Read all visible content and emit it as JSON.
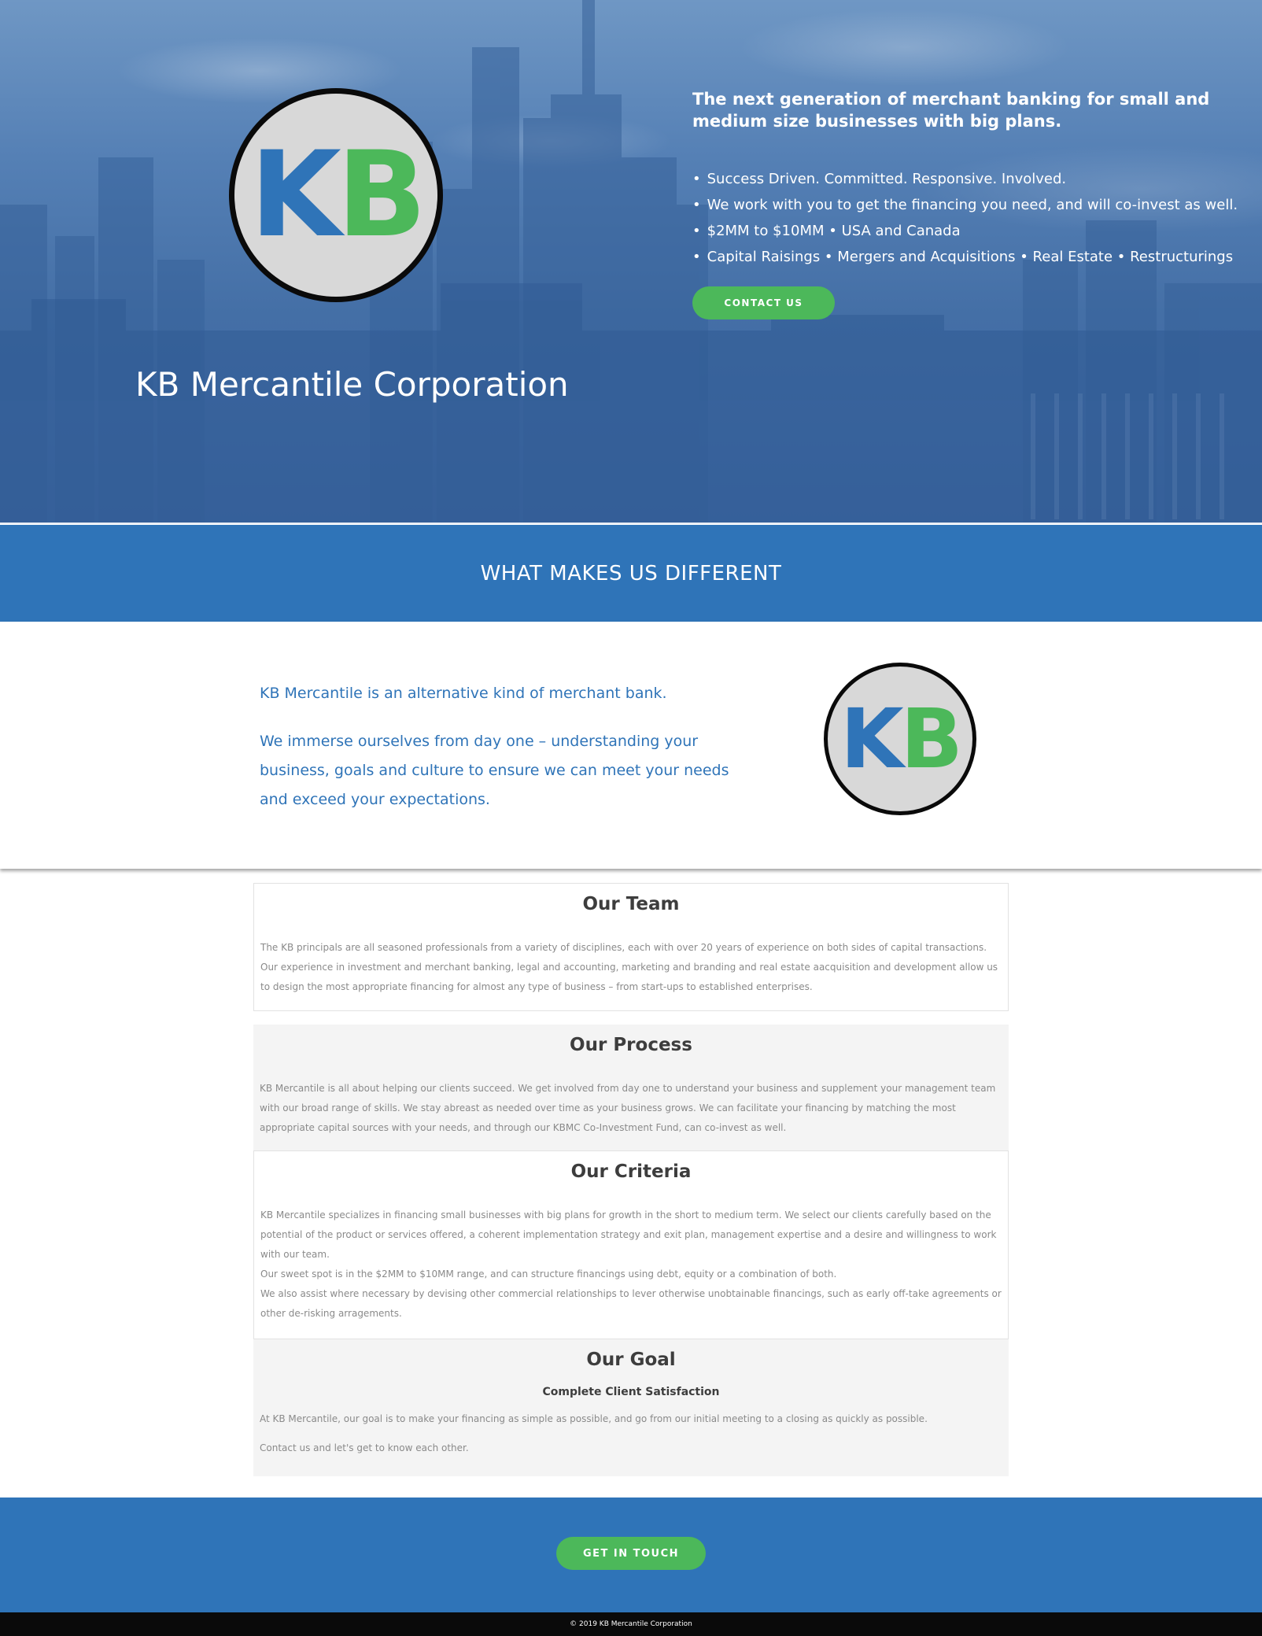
{
  "hero": {
    "logo": {
      "k": "K",
      "b": "B",
      "k_color": "#2f74b8",
      "b_color": "#4cb85a"
    },
    "company_name": "KB Mercantile Corporation",
    "tagline": "The next generation of merchant banking for small and medium size businesses with big plans.",
    "bullets": [
      "Success Driven. Committed. Responsive. Involved.",
      "We work with you to get the financing you need, and will co-invest as well.",
      "$2MM to $10MM • USA and Canada",
      "Capital Raisings • Mergers and Acquisitions • Real Estate • Restructurings"
    ],
    "contact_button": "CONTACT US"
  },
  "band": {
    "title": "WHAT MAKES US DIFFERENT"
  },
  "intro": {
    "line1": "KB Mercantile is an alternative kind of merchant bank.",
    "line2": "We immerse ourselves from day one – understanding your business, goals and culture to ensure we can meet your needs and exceed your expectations."
  },
  "sections": {
    "team": {
      "title": "Our Team",
      "body": "The KB principals are all seasoned professionals from a variety of disciplines, each with over 20 years of experience on both sides of capital transactions. Our experience in investment and merchant banking, legal and accounting, marketing and branding and real estate aacquisition and development allow us to design the most appropriate financing for almost any type of business – from start-ups to established enterprises."
    },
    "process": {
      "title": "Our Process",
      "body": "KB Mercantile is all about helping our clients succeed. We get involved from day one to understand your business and supplement your management team with our broad range of skills. We stay abreast as needed over time as your business grows. We can facilitate your financing by matching the most appropriate capital sources with your needs, and through our KBMC Co-Investment Fund, can co-invest as well."
    },
    "criteria": {
      "title": "Our Criteria",
      "body1": "KB Mercantile specializes in financing small businesses with big plans for growth in the short to medium term. We select our clients carefully based on the potential of the product or services offered, a coherent implementation strategy and exit plan, management expertise and a desire and willingness to work with our team.",
      "body2": "Our sweet spot is in the $2MM to $10MM range, and can structure financings using debt, equity or a combination of both.",
      "body3": "We also assist where necessary by devising other commercial relationships to lever otherwise unobtainable financings, such as early off-take agreements or other de-risking arragements."
    },
    "goal": {
      "title": "Our Goal",
      "subtitle": "Complete Client Satisfaction",
      "body1": "At KB Mercantile, our goal is to make your financing as simple as possible, and go from our initial meeting to a closing as quickly as possible.",
      "body2": "Contact us and let's get to know each other."
    }
  },
  "cta": {
    "button": "GET IN TOUCH"
  },
  "footer": {
    "copyright": "© 2019 KB Mercantile Corporation"
  }
}
